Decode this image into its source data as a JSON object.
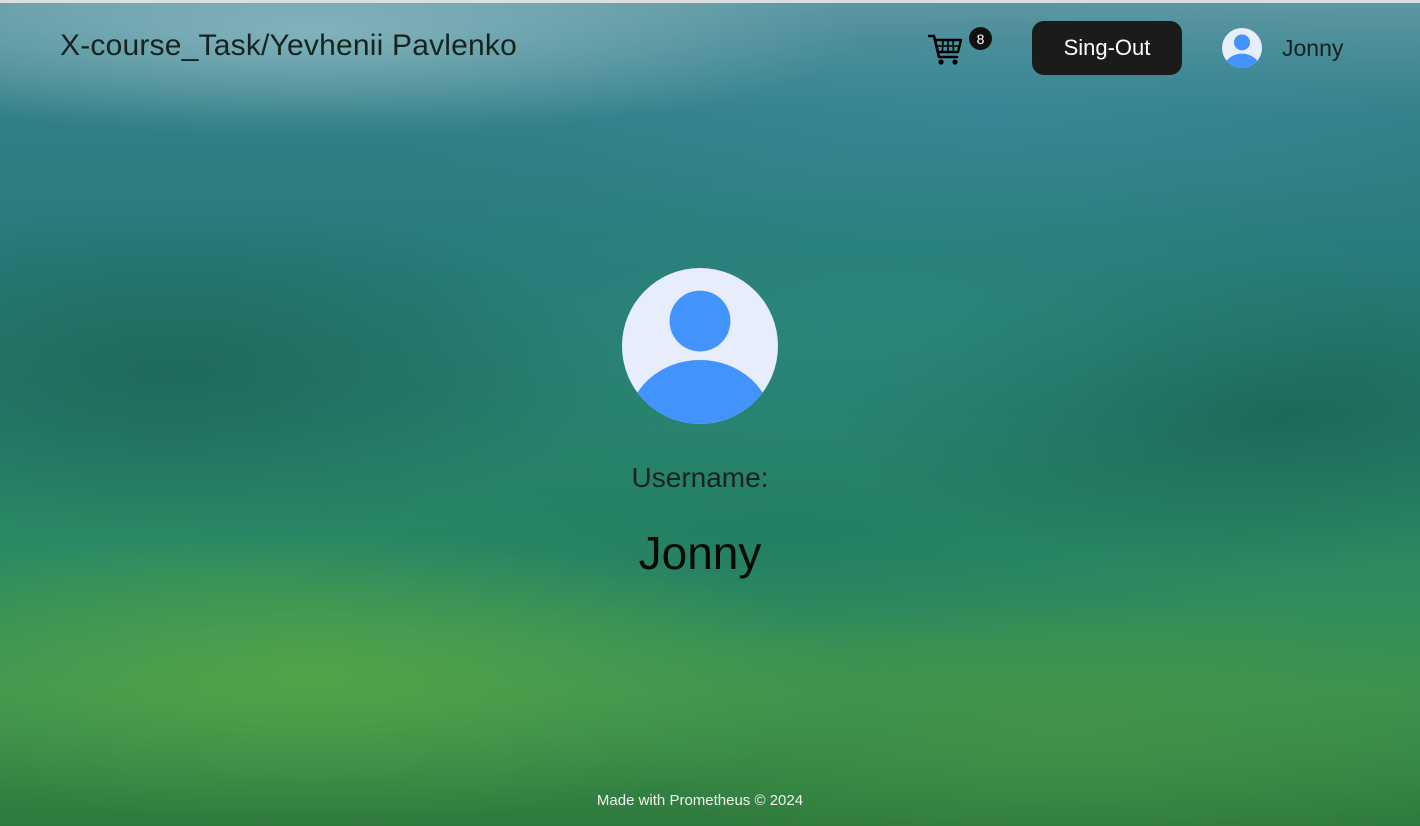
{
  "header": {
    "brand": "X-course_Task/Yevhenii Pavlenko",
    "cart": {
      "icon": "shopping-cart-icon",
      "count": "8"
    },
    "signout_label": "Sing-Out",
    "user": {
      "avatar_icon": "user-avatar-icon",
      "name": "Jonny"
    }
  },
  "profile": {
    "avatar_icon": "user-avatar-icon",
    "username_label": "Username:",
    "username": "Jonny"
  },
  "footer": {
    "text": "Made with Prometheus © 2024"
  },
  "colors": {
    "avatar_background": "#e8edfb",
    "avatar_figure": "#4293fb",
    "button_background": "#1b1b1b",
    "badge_background": "#111111"
  }
}
